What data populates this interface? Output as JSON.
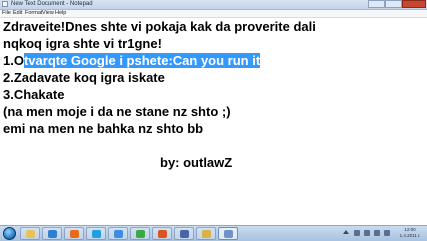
{
  "window": {
    "title": "New Text Document - Notepad"
  },
  "menu": [
    "File",
    "Edit",
    "Format",
    "View",
    "Help"
  ],
  "document": {
    "lines": [
      {
        "text": "Zdraveite!Dnes shte vi pokaja kak da proverite dali"
      },
      {
        "text": "nqkoq igra shte vi tr1gne!"
      },
      {
        "before": "1.O",
        "selected": "tvarqte Google i pshete:Can you run it"
      },
      {
        "text": "2.Zadavate koq igra iskate"
      },
      {
        "text": "3.Chakate"
      },
      {
        "text": "(na men moje i da ne stane nz shto ;)"
      },
      {
        "text": "emi na men ne bahka nz shto bb"
      },
      {
        "text": "by: outlawZ"
      }
    ]
  },
  "taskbar": {
    "apps": [
      {
        "name": "explorer-icon",
        "color": "#e8c25a"
      },
      {
        "name": "media-player-icon",
        "color": "#2f7fd0"
      },
      {
        "name": "firefox-icon",
        "color": "#e86a1a"
      },
      {
        "name": "skype-icon",
        "color": "#1ea0e0"
      },
      {
        "name": "browser-icon",
        "color": "#3c8fe0"
      },
      {
        "name": "chrome-icon",
        "color": "#3aa845"
      },
      {
        "name": "firefox-icon-2",
        "color": "#d9541f"
      },
      {
        "name": "media-icon",
        "color": "#4a64a8"
      },
      {
        "name": "folder-icon",
        "color": "#d9b24a"
      },
      {
        "name": "notepad-icon",
        "color": "#6f93c9"
      }
    ],
    "clock": {
      "time": "12:00",
      "date": "1.4.2011 г."
    }
  },
  "colors": {
    "selection": "#3399ff",
    "close_button": "#c8452f"
  }
}
